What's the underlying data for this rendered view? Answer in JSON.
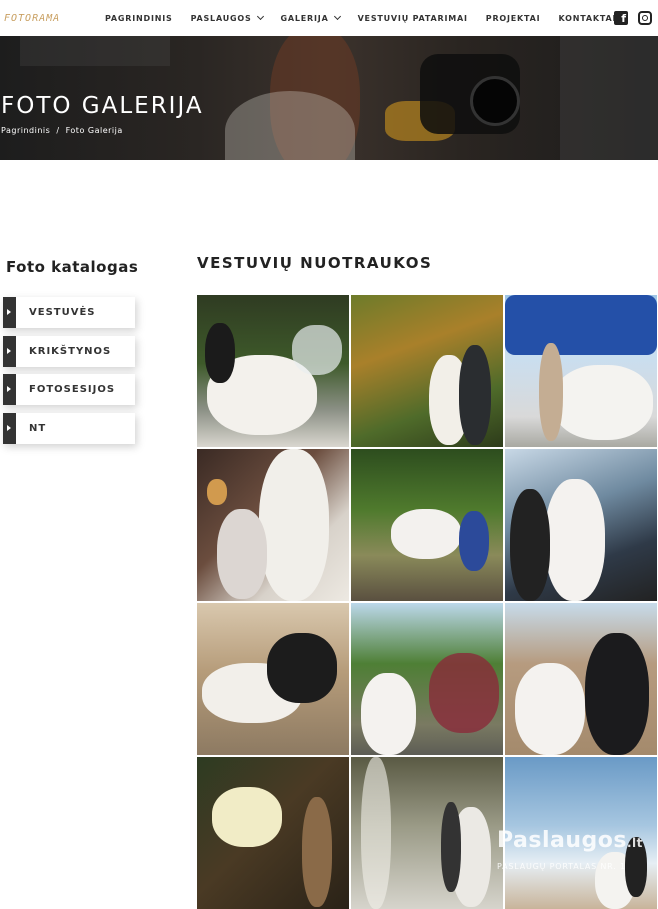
{
  "brand": {
    "logo_text": "FOTORAMA"
  },
  "nav": {
    "items": [
      {
        "label": "PAGRINDINIS",
        "dropdown": false
      },
      {
        "label": "PASLAUGOS",
        "dropdown": true
      },
      {
        "label": "GALERIJA",
        "dropdown": true
      },
      {
        "label": "VESTUVIŲ PATARIMAI",
        "dropdown": false
      },
      {
        "label": "PROJEKTAI",
        "dropdown": false
      },
      {
        "label": "KONTAKTAI",
        "dropdown": false
      }
    ],
    "social": [
      "facebook-icon",
      "instagram-icon"
    ]
  },
  "hero": {
    "title": "FOTO GALERIJA",
    "breadcrumb": [
      "Pagrindinis",
      "/",
      "Foto Galerija"
    ]
  },
  "sidebar": {
    "title": "Foto katalogas",
    "items": [
      {
        "label": "VESTUVĖS"
      },
      {
        "label": "KRIKŠTYNOS"
      },
      {
        "label": "FOTOSESIJOS"
      },
      {
        "label": "NT"
      }
    ]
  },
  "gallery": {
    "title": "VESTUVIŲ NUOTRAUKOS",
    "photo_count": 12
  },
  "watermark": {
    "name": "Paslaugos",
    "suffix": ".lt",
    "tagline": "PASLAUGŲ PORTALAS NR. 1"
  },
  "colors": {
    "logo": "#c9a062",
    "sidebar_bar": "#333333",
    "text_dark": "#222222"
  }
}
